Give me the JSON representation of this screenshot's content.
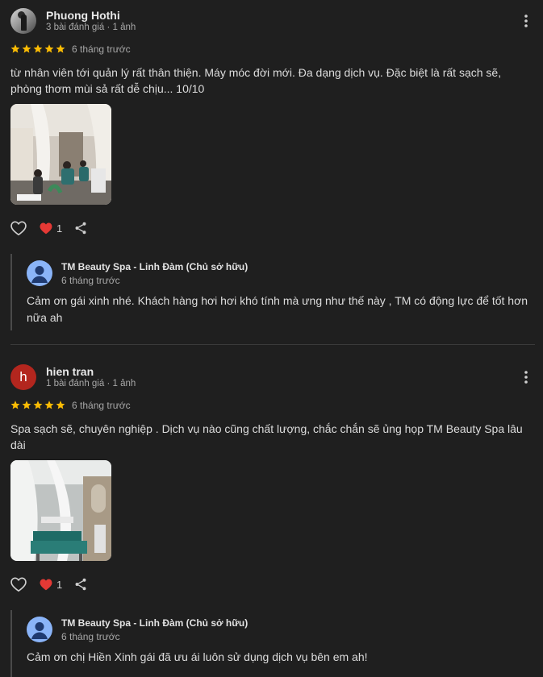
{
  "reviews": [
    {
      "author": "Phuong Hothi",
      "meta": "3 bài đánh giá · 1 ảnh",
      "avatar": "photo",
      "rating": 5,
      "time": "6 tháng trước",
      "text": "từ nhân viên tới quản lý rất thân thiện. Máy móc đời mới. Đa dạng dịch vụ. Đặc biệt là rất sạch sẽ, phòng thơm mùi sả rất dễ chịu... 10/10",
      "photo_icon": "spa-interior-photo",
      "like_count": "1",
      "reply": {
        "owner": "TM Beauty Spa - Linh Đàm (Chủ sở hữu)",
        "time": "6 tháng trước",
        "text": "Cảm ơn gái xinh nhé. Khách hàng hơi hơi khó tính mà ưng như thế này , TM có động lực để tốt hơn nữa ah"
      }
    },
    {
      "author": "hien tran",
      "meta": "1 bài đánh giá · 1 ảnh",
      "avatar_letter": "h",
      "avatar_color": "#b3261e",
      "rating": 5,
      "time": "6 tháng trước",
      "text": "Spa sạch sẽ, chuyên nghiệp . Dịch vụ nào cũng chất lượng, chắc chắn sẽ ủng họp TM Beauty Spa lâu dài",
      "photo_icon": "spa-beds-photo",
      "like_count": "1",
      "reply": {
        "owner": "TM Beauty Spa - Linh Đàm (Chủ sở hữu)",
        "time": "6 tháng trước",
        "text": "Cảm ơn chị Hiền Xinh gái đã ưu ái luôn sử dụng dịch vụ bên em ah!"
      }
    }
  ],
  "colors": {
    "background": "#1f1f1f",
    "star": "#fbbc04",
    "heart": "#e53935",
    "owner_avatar": "#8ab4f8"
  }
}
